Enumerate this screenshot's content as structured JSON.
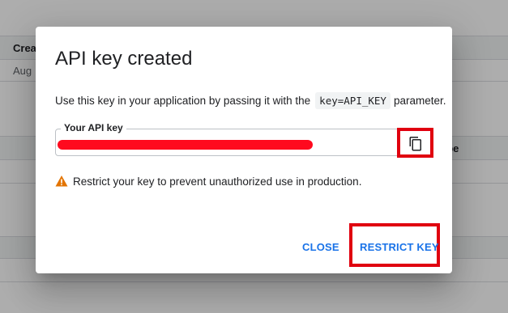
{
  "background": {
    "col_created": "Creat",
    "row_date": "Aug",
    "col_type": "ype"
  },
  "dialog": {
    "title": "API key created",
    "description_prefix": "Use this key in your application by passing it with the",
    "description_code": "key=API_KEY",
    "description_suffix": "parameter.",
    "key_field": {
      "label": "Your API key",
      "value_redacted": true,
      "redaction_color": "#ff0a1e"
    },
    "copy_icon": "copy-icon",
    "warning": {
      "icon": "warning-icon",
      "icon_color": "#e37400",
      "text": "Restrict your key to prevent unauthorized use in production."
    },
    "actions": {
      "close_label": "CLOSE",
      "restrict_label": "RESTRICT KEY"
    }
  },
  "colors": {
    "accent": "#1a73e8",
    "highlight_box": "#e0000f",
    "scrim": "rgba(0,0,0,0.32)"
  }
}
